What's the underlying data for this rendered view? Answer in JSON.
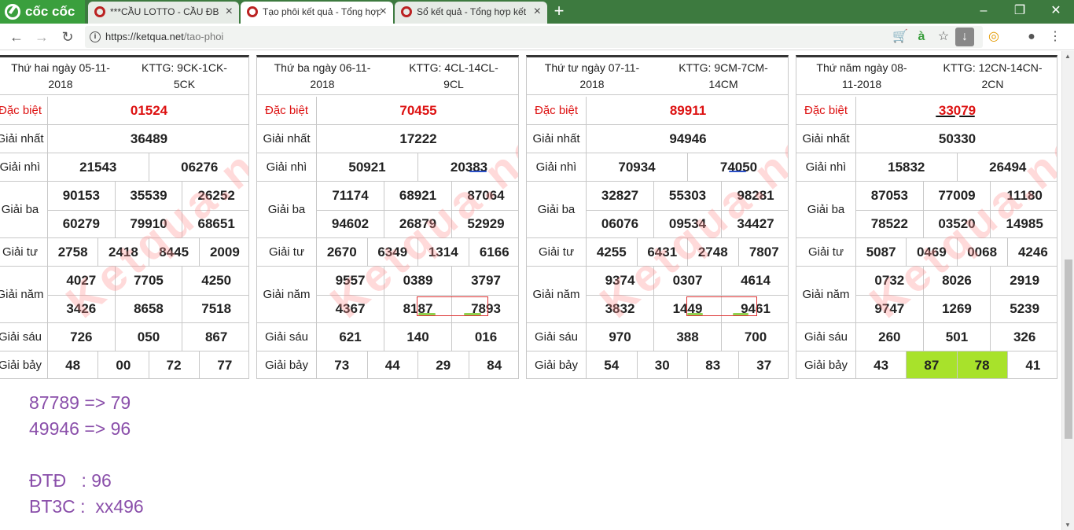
{
  "browser": {
    "logo": "cốc cốc",
    "tabs": [
      {
        "label": "***CẦU LOTTO - CẦU ĐB"
      },
      {
        "label": "Tạo phôi kết quả - Tổng hợp"
      },
      {
        "label": "Sổ kết quả - Tổng hợp kết"
      }
    ],
    "url_host": "https://ketqua.net",
    "url_path": "/tao-phoi",
    "colors": {
      "tabbar": "#3d7a3f",
      "accent": "#3a9f3d"
    }
  },
  "labels": {
    "db": "Đặc biệt",
    "g1": "Giải nhất",
    "g2": "Giải nhì",
    "g3": "Giải ba",
    "g4": "Giải tư",
    "g5": "Giải năm",
    "g6": "Giải sáu",
    "g7": "Giải bảy"
  },
  "panels": [
    {
      "date_line1": "Thứ hai ngày 05-11-",
      "date_line2": "2018",
      "kttg_line1": "KTTG: 9CK-1CK-",
      "kttg_line2": "5CK",
      "lbl": {
        "db": "Đặc biệt",
        "g1": "Giải nhất",
        "g2": "Giải nhì",
        "g3": "Giải ba",
        "g4": "Giải tư",
        "g5": "Giải năm",
        "g6": "Giải sáu",
        "g7": "Giải bảy"
      },
      "db": "01524",
      "g1": "36489",
      "g2": [
        "21543",
        "06276"
      ],
      "g3": [
        "90153",
        "35539",
        "26252",
        "60279",
        "79910",
        "68651"
      ],
      "g4": [
        "2758",
        "2418",
        "8445",
        "2009"
      ],
      "g5": [
        "4027",
        "7705",
        "4250",
        "3426",
        "8658",
        "7518"
      ],
      "g6": [
        "726",
        "050",
        "867"
      ],
      "g7": [
        "48",
        "00",
        "72",
        "77"
      ]
    },
    {
      "date_line1": "Thứ ba ngày 06-11-",
      "date_line2": "2018",
      "kttg_line1": "KTTG: 4CL-14CL-",
      "kttg_line2": "9CL",
      "lbl": {
        "db": "Đặc biệt",
        "g1": "Giải nhất",
        "g2": "Giải nhì",
        "g3": "Giải ba",
        "g4": "Giải tư",
        "g5": "Giải năm",
        "g6": "Giải sáu",
        "g7": "Giải bảy"
      },
      "db": "70455",
      "g1": "17222",
      "g2": [
        "50921",
        "20383"
      ],
      "g3": [
        "71174",
        "68921",
        "87064",
        "94602",
        "26879",
        "52929"
      ],
      "g4": [
        "2670",
        "6349",
        "1314",
        "6166"
      ],
      "g5": [
        "9557",
        "0389",
        "3797",
        "4367",
        "8187",
        "7893"
      ],
      "g6": [
        "621",
        "140",
        "016"
      ],
      "g7": [
        "73",
        "44",
        "29",
        "84"
      ]
    },
    {
      "date_line1": "Thứ tư ngày 07-11-",
      "date_line2": "2018",
      "kttg_line1": "KTTG: 9CM-7CM-",
      "kttg_line2": "14CM",
      "lbl": {
        "db": "Đặc biệt",
        "g1": "Giải nhất",
        "g2": "Giải nhì",
        "g3": "Giải ba",
        "g4": "Giải tư",
        "g5": "Giải năm",
        "g6": "Giải sáu",
        "g7": "Giải bảy"
      },
      "db": "89911",
      "g1": "94946",
      "g2": [
        "70934",
        "74050"
      ],
      "g3": [
        "32827",
        "55303",
        "98281",
        "06076",
        "09534",
        "34427"
      ],
      "g4": [
        "4255",
        "6431",
        "2748",
        "7807"
      ],
      "g5": [
        "9374",
        "0307",
        "4614",
        "3832",
        "1449",
        "9461"
      ],
      "g6": [
        "970",
        "388",
        "700"
      ],
      "g7": [
        "54",
        "30",
        "83",
        "37"
      ]
    },
    {
      "date_line1": "Thứ năm ngày 08-",
      "date_line2": "11-2018",
      "kttg_line1": "KTTG: 12CN-14CN-",
      "kttg_line2": "2CN",
      "lbl": {
        "db": "Đặc biệt",
        "g1": "Giải nhất",
        "g2": "Giải nhì",
        "g3": "Giải ba",
        "g4": "Giải tư",
        "g5": "Giải năm",
        "g6": "Giải sáu",
        "g7": "Giải bảy"
      },
      "db": "33079",
      "g1": "50330",
      "g2": [
        "15832",
        "26494"
      ],
      "g3": [
        "87053",
        "77009",
        "11180",
        "78522",
        "03520",
        "14985"
      ],
      "g4": [
        "5087",
        "0469",
        "0068",
        "4246"
      ],
      "g5": [
        "0732",
        "8026",
        "2919",
        "9747",
        "1269",
        "5239"
      ],
      "g6": [
        "260",
        "501",
        "326"
      ],
      "g7": [
        "43",
        "87",
        "78",
        "41"
      ],
      "highlight_color": "#a8e22b"
    }
  ],
  "watermark": "Ketqua.net",
  "notes": [
    "87789 => 79",
    "49946 => 96",
    "ĐTĐ   : 96",
    "BT3C :  xx496"
  ],
  "notes_color": "#8a4faa"
}
